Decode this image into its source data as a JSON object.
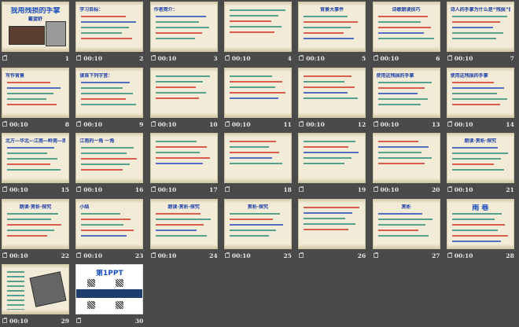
{
  "slides": [
    {
      "n": "1",
      "time": "",
      "title": "我用残损的手掌",
      "subtitle": "戴望舒",
      "kind": "cover"
    },
    {
      "n": "2",
      "time": "00:10",
      "title": "学习目标："
    },
    {
      "n": "3",
      "time": "00:10",
      "title": "作者简介："
    },
    {
      "n": "4",
      "time": "00:10",
      "title": ""
    },
    {
      "n": "5",
      "time": "00:10",
      "title": "背景大事件",
      "center": true
    },
    {
      "n": "6",
      "time": "00:10",
      "title": "诗歌朗读技巧",
      "center": true
    },
    {
      "n": "7",
      "time": "00:10",
      "title": "诗人的手掌为什么是“残损”的？"
    },
    {
      "n": "8",
      "time": "00:10",
      "title": "写作背景"
    },
    {
      "n": "9",
      "time": "00:10",
      "title": "读准下列字音："
    },
    {
      "n": "10",
      "time": "00:10",
      "title": "",
      "center": true
    },
    {
      "n": "11",
      "time": "00:10",
      "title": ""
    },
    {
      "n": "12",
      "time": "00:10",
      "title": ""
    },
    {
      "n": "13",
      "time": "00:10",
      "title": "使用这残损的手掌"
    },
    {
      "n": "14",
      "time": "00:10",
      "title": "使用这残损的手掌"
    },
    {
      "n": "15",
      "time": "00:10",
      "title": "北方—华北—江南—岭南—南海",
      "center": true
    },
    {
      "n": "16",
      "time": "00:10",
      "title": "江南的一角 一角"
    },
    {
      "n": "17",
      "time": "00:10",
      "title": ""
    },
    {
      "n": "18",
      "time": "",
      "title": ""
    },
    {
      "n": "19",
      "time": "",
      "title": ""
    },
    {
      "n": "20",
      "time": "00:10",
      "title": ""
    },
    {
      "n": "21",
      "time": "00:10",
      "title": "朗读·赏析·探究",
      "center": true
    },
    {
      "n": "22",
      "time": "00:10",
      "title": "朗读·赏析·探究",
      "center": true
    },
    {
      "n": "23",
      "time": "00:10",
      "title": "小结"
    },
    {
      "n": "24",
      "time": "00:10",
      "title": "朗读·赏析·探究",
      "center": true
    },
    {
      "n": "25",
      "time": "00:10",
      "title": "赏析·探究",
      "center": true
    },
    {
      "n": "26",
      "time": "",
      "title": "",
      "center": true
    },
    {
      "n": "27",
      "time": "",
      "title": "赏析",
      "center": true
    },
    {
      "n": "28",
      "time": "00:10",
      "title": "雨 巷",
      "center": true,
      "big": true
    },
    {
      "n": "29",
      "time": "00:10",
      "title": "",
      "kind": "photo"
    },
    {
      "n": "30",
      "time": "",
      "title": "第1PPT",
      "kind": "white"
    }
  ]
}
